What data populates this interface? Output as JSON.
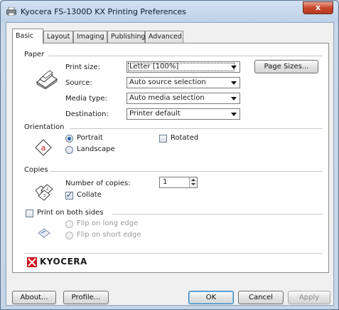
{
  "window": {
    "title": "Kyocera FS-1300D KX Printing Preferences",
    "close_label": "x"
  },
  "tabs": [
    {
      "label": "Basic",
      "active": true
    },
    {
      "label": "Layout"
    },
    {
      "label": "Imaging"
    },
    {
      "label": "Publishing"
    },
    {
      "label": "Advanced"
    }
  ],
  "paper": {
    "section_label": "Paper",
    "print_size_label": "Print size:",
    "print_size_value": "Letter  [100%]",
    "page_sizes_button": "Page Sizes...",
    "source_label": "Source:",
    "source_value": "Auto source selection",
    "media_type_label": "Media type:",
    "media_type_value": "Auto media selection",
    "destination_label": "Destination:",
    "destination_value": "Printer default"
  },
  "orientation": {
    "section_label": "Orientation",
    "portrait_label": "Portrait",
    "landscape_label": "Landscape",
    "rotated_label": "Rotated",
    "selected": "portrait",
    "rotated_checked": false
  },
  "copies": {
    "section_label": "Copies",
    "number_label": "Number of copies:",
    "number_value": "1",
    "collate_label": "Collate",
    "collate_checked": true
  },
  "duplex": {
    "label": "Print on both sides",
    "checked": false,
    "long_edge_label": "Flip on long edge",
    "short_edge_label": "Flip on short edge"
  },
  "brand": {
    "logo_text": "KYOCERA",
    "color": "#d0121b"
  },
  "footer": {
    "about": "About...",
    "profile": "Profile...",
    "ok": "OK",
    "cancel": "Cancel",
    "apply": "Apply"
  }
}
